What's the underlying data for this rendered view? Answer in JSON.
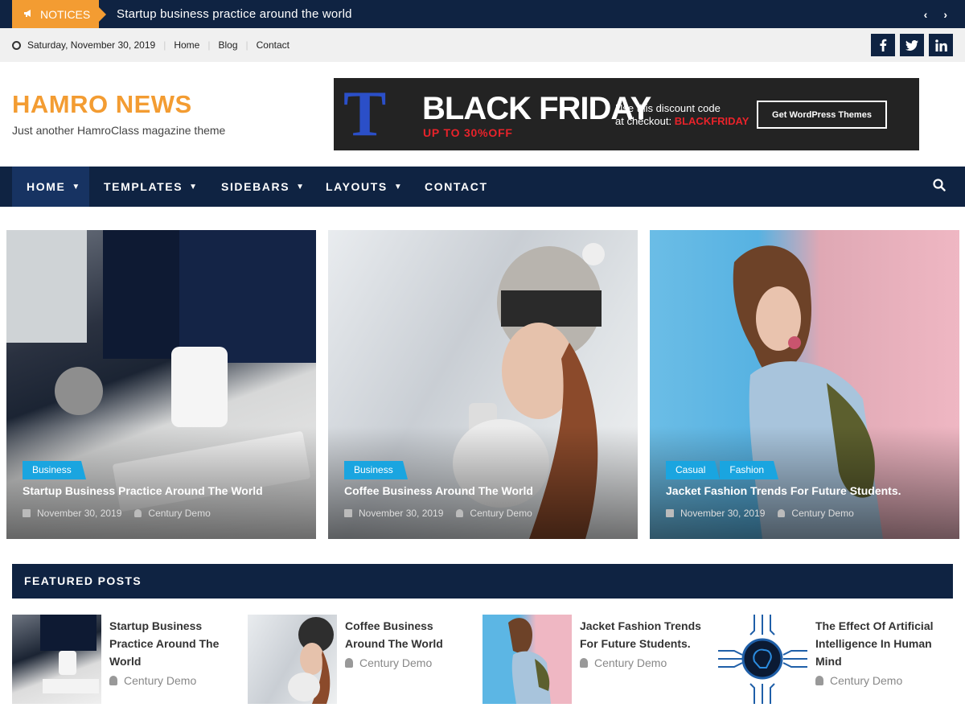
{
  "notice": {
    "label": "NOTICES",
    "text": "Startup business practice around the world",
    "prev": "‹",
    "next": "›"
  },
  "topbar": {
    "date": "Saturday, November 30, 2019",
    "links": [
      "Home",
      "Blog",
      "Contact"
    ],
    "social": [
      "f",
      "t",
      "in"
    ]
  },
  "site": {
    "title": "HAMRO NEWS",
    "tagline": "Just another HamroClass magazine theme"
  },
  "ad": {
    "logo": "T",
    "headline": "BLACK FRIDAY",
    "sub": "UP TO 30%OFF",
    "code_line1": "Use this discount code",
    "code_line2": "at checkout: ",
    "code": "BLACKFRIDAY",
    "button": "Get WordPress Themes"
  },
  "nav": {
    "items": [
      "HOME",
      "TEMPLATES",
      "SIDEBARS",
      "LAYOUTS",
      "CONTACT"
    ]
  },
  "hero": [
    {
      "cats": [
        "Business"
      ],
      "title": "Startup Business Practice Around The World",
      "date": "November 30, 2019",
      "author": "Century Demo"
    },
    {
      "cats": [
        "Business"
      ],
      "title": "Coffee Business Around The World",
      "date": "November 30, 2019",
      "author": "Century Demo"
    },
    {
      "cats": [
        "Casual",
        "Fashion"
      ],
      "title": "Jacket Fashion Trends For Future Students.",
      "date": "November 30, 2019",
      "author": "Century Demo"
    }
  ],
  "featured": {
    "heading": "FEATURED POSTS",
    "posts": [
      {
        "title": "Startup Business Practice Around The World",
        "author": "Century Demo"
      },
      {
        "title": "Coffee Business Around The World",
        "author": "Century Demo"
      },
      {
        "title": "Jacket Fashion Trends For Future Students.",
        "author": "Century Demo"
      },
      {
        "title": "The Effect Of Artificial Intelligence In Human Mind",
        "author": "Century Demo"
      }
    ]
  },
  "colors": {
    "navy": "#0f2342",
    "accent": "#f39c32",
    "category": "#1aa5e0",
    "ad_red": "#e8232a"
  }
}
